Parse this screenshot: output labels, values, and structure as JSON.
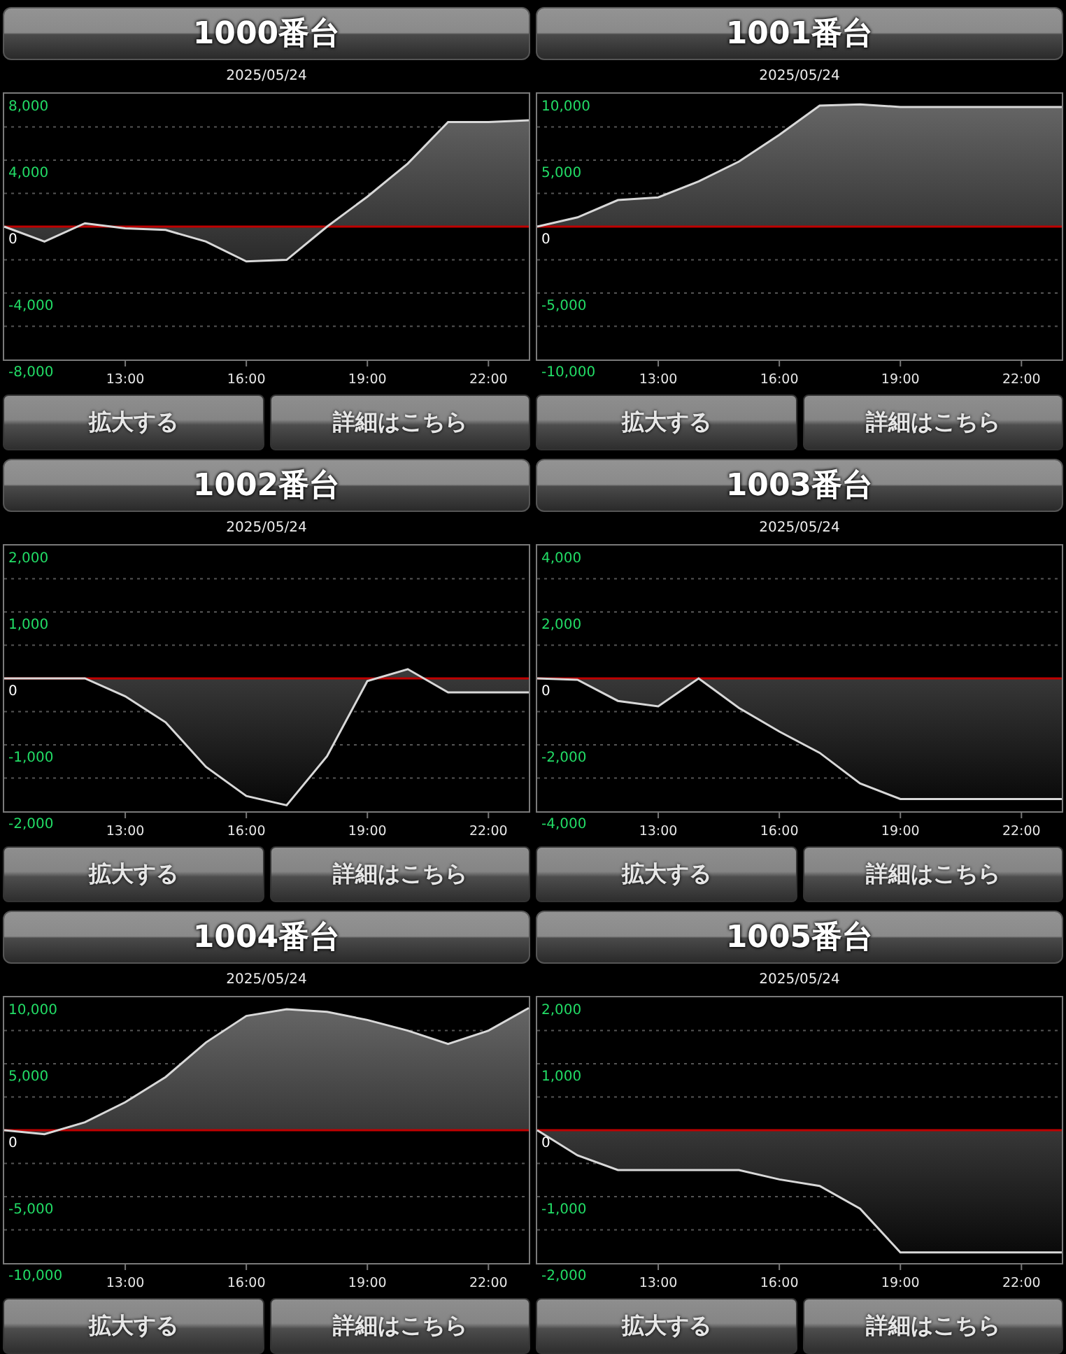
{
  "panels": [
    {
      "title": "1000番台",
      "chart_data": {
        "type": "area",
        "title": "2025/05/24",
        "x": [
          10,
          11,
          12,
          13,
          14,
          15,
          16,
          17,
          18,
          19,
          20,
          21,
          22,
          23
        ],
        "xlim": [
          10,
          23
        ],
        "ylim": [
          -8000,
          8000
        ],
        "xticks": [
          {
            "value": 13,
            "label": "13:00"
          },
          {
            "value": 16,
            "label": "16:00"
          },
          {
            "value": 19,
            "label": "19:00"
          },
          {
            "value": 22,
            "label": "22:00"
          }
        ],
        "yticks": [
          {
            "value": 8000,
            "label": "8,000"
          },
          {
            "value": 4000,
            "label": "4,000"
          },
          {
            "value": 0,
            "label": "0"
          },
          {
            "value": -4000,
            "label": "-4,000"
          },
          {
            "value": -8000,
            "label": "-8,000"
          }
        ],
        "values": [
          0,
          -900,
          200,
          -100,
          -200,
          -900,
          -2100,
          -2000,
          0,
          1800,
          3800,
          6300,
          6300,
          6400
        ],
        "ref_lines": [
          {
            "axis": "y",
            "value": 0,
            "color": "#c00000"
          }
        ]
      },
      "buttons": [
        "拡大する",
        "詳細はこちら"
      ]
    },
    {
      "title": "1001番台",
      "chart_data": {
        "type": "area",
        "title": "2025/05/24",
        "x": [
          10,
          11,
          12,
          13,
          14,
          15,
          16,
          17,
          18,
          19,
          20,
          21,
          22,
          23
        ],
        "xlim": [
          10,
          23
        ],
        "ylim": [
          -10000,
          10000
        ],
        "xticks": [
          {
            "value": 13,
            "label": "13:00"
          },
          {
            "value": 16,
            "label": "16:00"
          },
          {
            "value": 19,
            "label": "19:00"
          },
          {
            "value": 22,
            "label": "22:00"
          }
        ],
        "yticks": [
          {
            "value": 10000,
            "label": "10,000"
          },
          {
            "value": 5000,
            "label": "5,000"
          },
          {
            "value": 0,
            "label": "0"
          },
          {
            "value": -5000,
            "label": "-5,000"
          },
          {
            "value": -10000,
            "label": "-10,000"
          }
        ],
        "values": [
          0,
          700,
          2000,
          2200,
          3400,
          4900,
          6900,
          9100,
          9200,
          9000,
          9000,
          9000,
          9000,
          9000
        ],
        "ref_lines": [
          {
            "axis": "y",
            "value": 0,
            "color": "#c00000"
          }
        ]
      },
      "buttons": [
        "拡大する",
        "詳細はこちら"
      ]
    },
    {
      "title": "1002番台",
      "chart_data": {
        "type": "area",
        "title": "2025/05/24",
        "x": [
          10,
          11,
          12,
          13,
          14,
          15,
          16,
          17,
          18,
          19,
          20,
          21,
          22,
          23
        ],
        "xlim": [
          10,
          23
        ],
        "ylim": [
          -2000,
          2000
        ],
        "xticks": [
          {
            "value": 13,
            "label": "13:00"
          },
          {
            "value": 16,
            "label": "16:00"
          },
          {
            "value": 19,
            "label": "19:00"
          },
          {
            "value": 22,
            "label": "22:00"
          }
        ],
        "yticks": [
          {
            "value": 2000,
            "label": "2,000"
          },
          {
            "value": 1000,
            "label": "1,000"
          },
          {
            "value": 0,
            "label": "0"
          },
          {
            "value": -1000,
            "label": "-1,000"
          },
          {
            "value": -2000,
            "label": "-2,000"
          }
        ],
        "values": [
          0,
          0,
          0,
          -270,
          -660,
          -1330,
          -1770,
          -1910,
          -1170,
          -40,
          140,
          -210,
          -210,
          -210
        ],
        "ref_lines": [
          {
            "axis": "y",
            "value": 0,
            "color": "#c00000"
          }
        ]
      },
      "buttons": [
        "拡大する",
        "詳細はこちら"
      ]
    },
    {
      "title": "1003番台",
      "chart_data": {
        "type": "area",
        "title": "2025/05/24",
        "x": [
          10,
          11,
          12,
          13,
          14,
          15,
          16,
          17,
          18,
          19,
          20,
          21,
          22,
          23
        ],
        "xlim": [
          10,
          23
        ],
        "ylim": [
          -4000,
          4000
        ],
        "xticks": [
          {
            "value": 13,
            "label": "13:00"
          },
          {
            "value": 16,
            "label": "16:00"
          },
          {
            "value": 19,
            "label": "19:00"
          },
          {
            "value": 22,
            "label": "22:00"
          }
        ],
        "yticks": [
          {
            "value": 4000,
            "label": "4,000"
          },
          {
            "value": 2000,
            "label": "2,000"
          },
          {
            "value": 0,
            "label": "0"
          },
          {
            "value": -2000,
            "label": "-2,000"
          },
          {
            "value": -4000,
            "label": "-4,000"
          }
        ],
        "values": [
          0,
          -40,
          -680,
          -840,
          0,
          -890,
          -1600,
          -2240,
          -3160,
          -3630,
          -3630,
          -3630,
          -3630,
          -3630
        ],
        "ref_lines": [
          {
            "axis": "y",
            "value": 0,
            "color": "#c00000"
          }
        ]
      },
      "buttons": [
        "拡大する",
        "詳細はこちら"
      ]
    },
    {
      "title": "1004番台",
      "chart_data": {
        "type": "area",
        "title": "2025/05/24",
        "x": [
          10,
          11,
          12,
          13,
          14,
          15,
          16,
          17,
          18,
          19,
          20,
          21,
          22,
          23
        ],
        "xlim": [
          10,
          23
        ],
        "ylim": [
          -10000,
          10000
        ],
        "xticks": [
          {
            "value": 13,
            "label": "13:00"
          },
          {
            "value": 16,
            "label": "16:00"
          },
          {
            "value": 19,
            "label": "19:00"
          },
          {
            "value": 22,
            "label": "22:00"
          }
        ],
        "yticks": [
          {
            "value": 10000,
            "label": "10,000"
          },
          {
            "value": 5000,
            "label": "5,000"
          },
          {
            "value": 0,
            "label": "0"
          },
          {
            "value": -5000,
            "label": "-5,000"
          },
          {
            "value": -10000,
            "label": "-10,000"
          }
        ],
        "values": [
          0,
          -300,
          600,
          2100,
          4000,
          6600,
          8600,
          9100,
          8900,
          8300,
          7500,
          6500,
          7500,
          9200
        ],
        "ref_lines": [
          {
            "axis": "y",
            "value": 0,
            "color": "#c00000"
          }
        ]
      },
      "buttons": [
        "拡大する",
        "詳細はこちら"
      ]
    },
    {
      "title": "1005番台",
      "chart_data": {
        "type": "area",
        "title": "2025/05/24",
        "x": [
          10,
          11,
          12,
          13,
          14,
          15,
          16,
          17,
          18,
          19,
          20,
          21,
          22,
          23
        ],
        "xlim": [
          10,
          23
        ],
        "ylim": [
          -2000,
          2000
        ],
        "xticks": [
          {
            "value": 13,
            "label": "13:00"
          },
          {
            "value": 16,
            "label": "16:00"
          },
          {
            "value": 19,
            "label": "19:00"
          },
          {
            "value": 22,
            "label": "22:00"
          }
        ],
        "yticks": [
          {
            "value": 2000,
            "label": "2,000"
          },
          {
            "value": 1000,
            "label": "1,000"
          },
          {
            "value": 0,
            "label": "0"
          },
          {
            "value": -1000,
            "label": "-1,000"
          },
          {
            "value": -2000,
            "label": "-2,000"
          }
        ],
        "values": [
          0,
          -380,
          -600,
          -600,
          -600,
          -600,
          -740,
          -840,
          -1180,
          -1840,
          -1840,
          -1840,
          -1840,
          -1840
        ],
        "ref_lines": [
          {
            "axis": "y",
            "value": 0,
            "color": "#c00000"
          }
        ]
      },
      "buttons": [
        "拡大する",
        "詳細はこちら"
      ]
    }
  ]
}
